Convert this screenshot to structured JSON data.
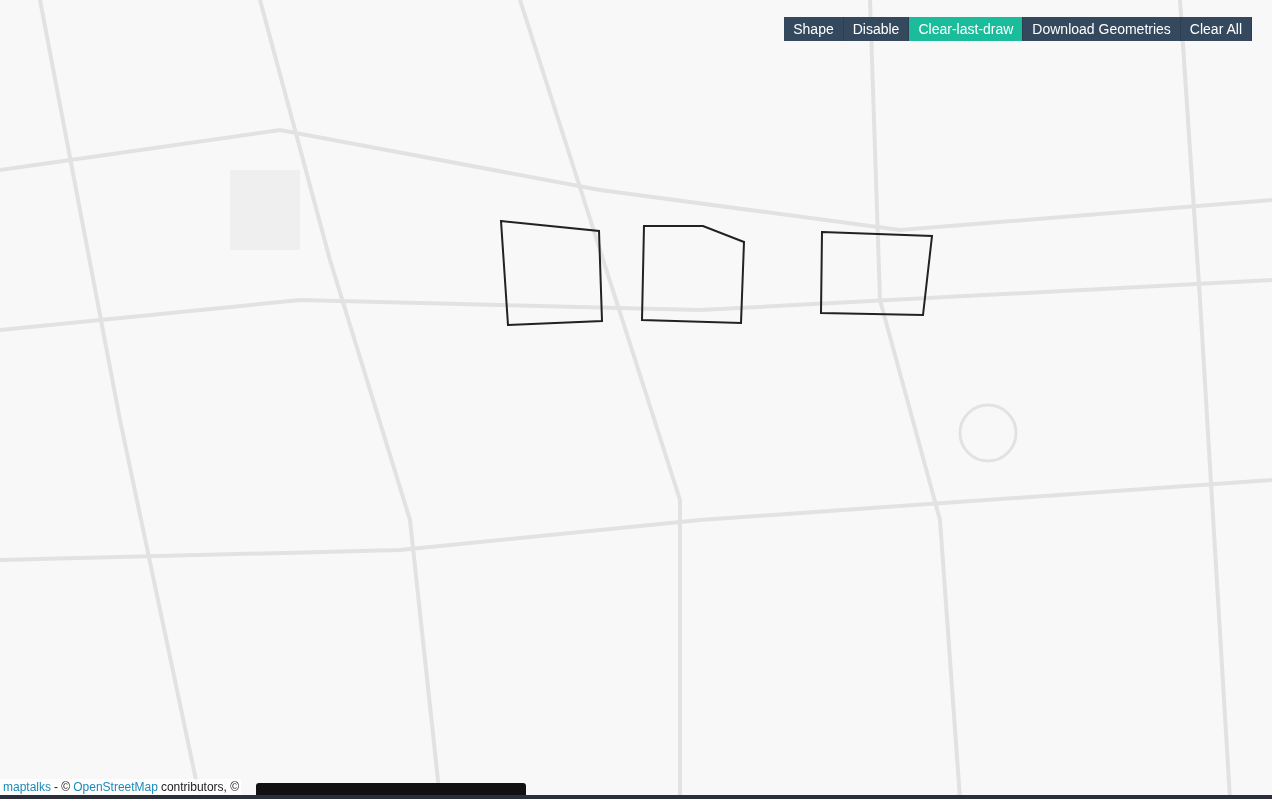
{
  "toolbar": [
    {
      "label": "Shape",
      "selected": false
    },
    {
      "label": "Disable",
      "selected": false
    },
    {
      "label": "Clear-last-draw",
      "selected": true
    },
    {
      "label": "Download Geometries",
      "selected": false
    },
    {
      "label": "Clear All",
      "selected": false
    }
  ],
  "attribution": {
    "link": "maptalks",
    "separator": "- ©",
    "source": "OpenStreetMap",
    "rest": "contributors, ©"
  }
}
